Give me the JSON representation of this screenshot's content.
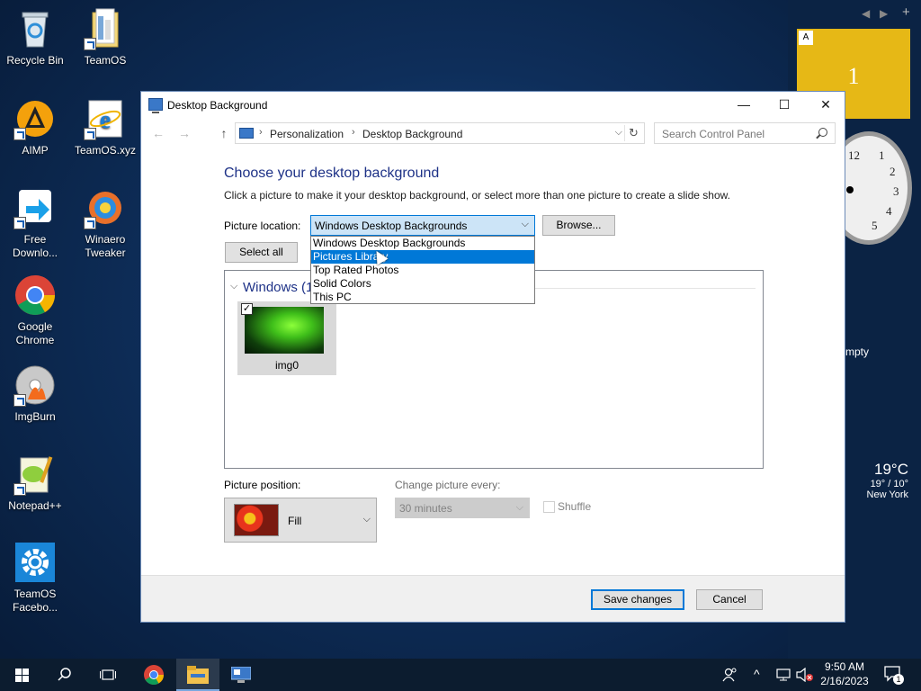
{
  "desktop": {
    "icons": [
      {
        "label": "Recycle Bin",
        "icon": "recycle-bin-icon"
      },
      {
        "label": "TeamOS",
        "icon": "folder-icon"
      },
      {
        "label": "AIMP",
        "icon": "aimp-icon"
      },
      {
        "label": "TeamOS.xyz",
        "icon": "internet-explorer-icon"
      },
      {
        "label": "Free Downlo...",
        "icon": "free-download-manager-icon"
      },
      {
        "label": "Winaero Tweaker",
        "icon": "winaero-tweaker-icon"
      },
      {
        "label": "Google Chrome",
        "icon": "chrome-icon"
      },
      {
        "label": "ImgBurn",
        "icon": "imgburn-icon"
      },
      {
        "label": "Notepad++",
        "icon": "notepadpp-icon"
      },
      {
        "label": "TeamOS Facebo...",
        "icon": "gear-icon"
      }
    ]
  },
  "gadgets": {
    "tile_letter": "A",
    "tile_number": "1",
    "clock_numbers": [
      "12",
      "1",
      "2",
      "3",
      "4",
      "5"
    ],
    "empty_text": "mpty",
    "weather": {
      "temp": "19°C",
      "range": "19° / 10°",
      "city": "New York"
    }
  },
  "window": {
    "title": "Desktop Background",
    "minimize": "—",
    "maximize": "☐",
    "close": "✕",
    "nav": {
      "back": "←",
      "forward": "→",
      "up": "↑"
    },
    "breadcrumb": [
      "Personalization",
      "Desktop Background"
    ],
    "refresh": "↻",
    "search_placeholder": "Search Control Panel",
    "heading": "Choose your desktop background",
    "description": "Click a picture to make it your desktop background, or select more than one picture to create a slide show.",
    "picture_location_label": "Picture location:",
    "picture_location_value": "Windows Desktop Backgrounds",
    "browse_label": "Browse...",
    "select_all_label": "Select all",
    "location_options": [
      "Windows Desktop Backgrounds",
      "Pictures Library",
      "Top Rated Photos",
      "Solid Colors",
      "This PC"
    ],
    "selected_option_index": 1,
    "group_title": "Windows (1",
    "thumbnail": {
      "label": "img0",
      "checked": "✓"
    },
    "picture_position_label": "Picture position:",
    "picture_position_value": "Fill",
    "change_picture_label": "Change picture every:",
    "change_picture_value": "30 minutes",
    "shuffle_label": "Shuffle",
    "save_label": "Save changes",
    "cancel_label": "Cancel"
  },
  "taskbar": {
    "time": "9:50 AM",
    "date": "2/16/2023",
    "notification_count": "1"
  },
  "colors": {
    "accent": "#0078d7",
    "heading": "#1e3287",
    "tile": "#e6b816",
    "taskbar": "#0c1c2f"
  }
}
